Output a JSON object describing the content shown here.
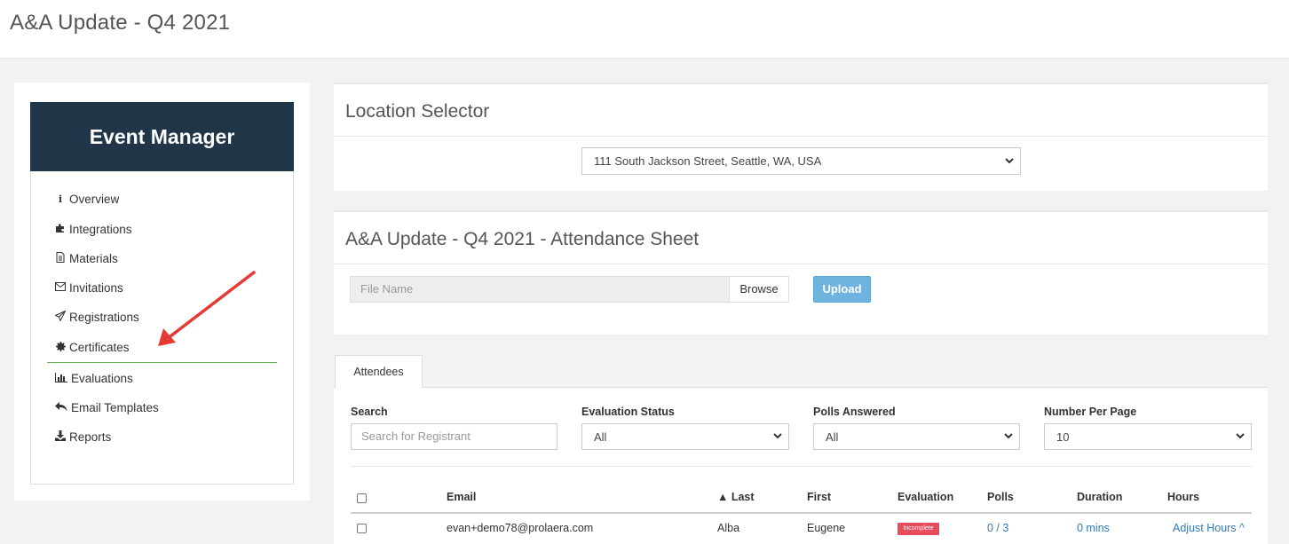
{
  "header": {
    "title": "A&A Update - Q4 2021"
  },
  "sidebar": {
    "title": "Event Manager",
    "items": [
      {
        "label": "Overview",
        "icon": "info-icon"
      },
      {
        "label": "Integrations",
        "icon": "puzzle-icon"
      },
      {
        "label": "Materials",
        "icon": "file-text-icon"
      },
      {
        "label": "Invitations",
        "icon": "envelope-icon"
      },
      {
        "label": "Registrations",
        "icon": "paper-plane-icon"
      },
      {
        "label": "Certificates",
        "icon": "certificate-icon"
      },
      {
        "label": "Evaluations",
        "icon": "bar-chart-icon"
      },
      {
        "label": "Email Templates",
        "icon": "reply-icon"
      },
      {
        "label": "Reports",
        "icon": "download-icon"
      }
    ],
    "active": "Certificates",
    "accent": "#6aa84f",
    "header_bg": "#213549"
  },
  "location": {
    "title": "Location Selector",
    "selected": "111 South Jackson Street, Seattle, WA, USA"
  },
  "attendance": {
    "title": "A&A Update - Q4 2021 - Attendance Sheet",
    "file_placeholder": "File Name",
    "browse_label": "Browse",
    "upload_label": "Upload"
  },
  "attendees": {
    "tab_label": "Attendees",
    "filters": {
      "search_label": "Search",
      "search_placeholder": "Search for Registrant",
      "eval_label": "Evaluation Status",
      "eval_value": "All",
      "polls_label": "Polls Answered",
      "polls_value": "All",
      "per_page_label": "Number Per Page",
      "per_page_value": "10"
    },
    "columns": {
      "email": "Email",
      "last": "▲ Last",
      "first": "First",
      "evaluation": "Evaluation",
      "polls": "Polls",
      "duration": "Duration",
      "hours": "Hours"
    },
    "rows": [
      {
        "email": "evan+demo78@prolaera.com",
        "last": "Alba",
        "first": "Eugene",
        "evaluation": "Incomplete",
        "polls": "0 / 3",
        "duration": "0 mins",
        "hours": "Adjust Hours ^"
      }
    ]
  }
}
